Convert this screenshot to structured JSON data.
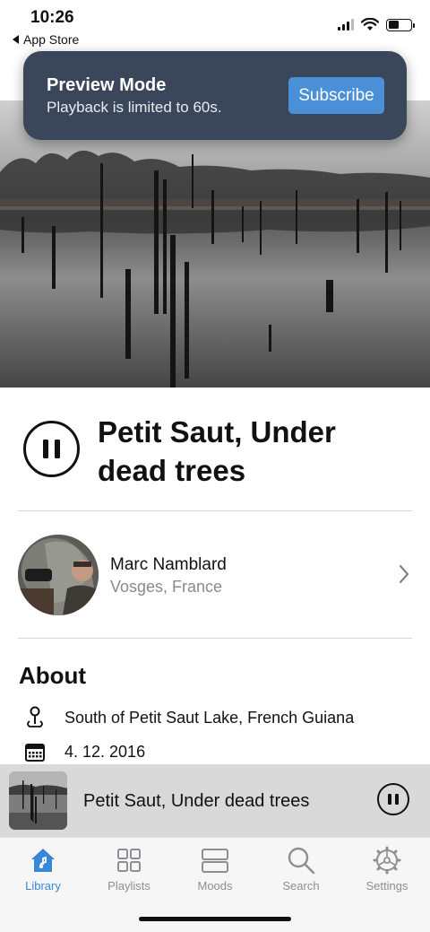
{
  "status_bar": {
    "time": "10:26",
    "back_app": "App Store"
  },
  "toast": {
    "title": "Preview Mode",
    "subtitle": "Playback is limited to 60s.",
    "subscribe_label": "Subscribe"
  },
  "track": {
    "title": "Petit Saut, Under dead trees",
    "state": "playing"
  },
  "artist": {
    "name": "Marc Namblard",
    "location": "Vosges, France"
  },
  "about": {
    "heading": "About",
    "location": "South of Petit Saut Lake, French Guiana",
    "date": "4. 12. 2016"
  },
  "mini_player": {
    "title": "Petit Saut, Under dead trees"
  },
  "tab_bar": {
    "tabs": [
      {
        "label": "Library",
        "icon": "house-icon",
        "active": true
      },
      {
        "label": "Playlists",
        "icon": "grid-icon",
        "active": false
      },
      {
        "label": "Moods",
        "icon": "moods-icon",
        "active": false
      },
      {
        "label": "Search",
        "icon": "search-icon",
        "active": false
      },
      {
        "label": "Settings",
        "icon": "gear-icon",
        "active": false
      }
    ]
  },
  "colors": {
    "accent": "#3a86d8",
    "toast_bg": "#3a4659",
    "subscribe_bg": "#4a90d9",
    "inactive_tab": "#8e8e93"
  }
}
